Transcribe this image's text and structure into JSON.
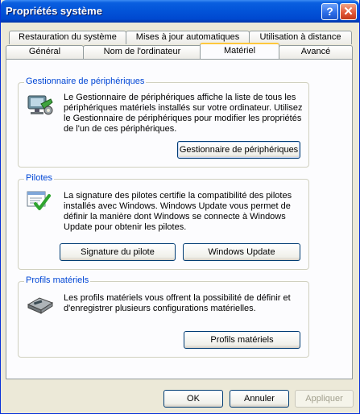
{
  "window": {
    "title": "Propriétés système"
  },
  "tabs": {
    "row1": [
      "Restauration du système",
      "Mises à jour automatiques",
      "Utilisation à distance"
    ],
    "row2": [
      "Général",
      "Nom de l'ordinateur",
      "Matériel",
      "Avancé"
    ],
    "active": "Matériel"
  },
  "device_manager": {
    "title": "Gestionnaire de périphériques",
    "description": "Le Gestionnaire de périphériques affiche la liste de tous les périphériques matériels installés sur votre ordinateur. Utilisez le Gestionnaire de périphériques pour modifier les propriétés de l'un de ces périphériques.",
    "button": "Gestionnaire de périphériques"
  },
  "drivers": {
    "title": "Pilotes",
    "description": "La signature des pilotes certifie la compatibilité des pilotes installés avec Windows. Windows Update vous permet de définir la manière dont Windows se connecte à Windows Update pour obtenir les pilotes.",
    "signing_button": "Signature du pilote",
    "update_button": "Windows Update"
  },
  "profiles": {
    "title": "Profils matériels",
    "description": "Les profils matériels vous offrent la possibilité de définir et d'enregistrer plusieurs configurations matérielles.",
    "button": "Profils matériels"
  },
  "footer": {
    "ok": "OK",
    "cancel": "Annuler",
    "apply": "Appliquer"
  },
  "icons": {
    "help": "help-icon",
    "close": "close-icon",
    "device_manager": "device-manager-icon",
    "drivers": "driver-signing-icon",
    "profiles": "hardware-profiles-icon"
  },
  "colors": {
    "titlebar": "#0253D8",
    "group_title": "#0046D5",
    "tab_highlight": "#FFC83C"
  }
}
